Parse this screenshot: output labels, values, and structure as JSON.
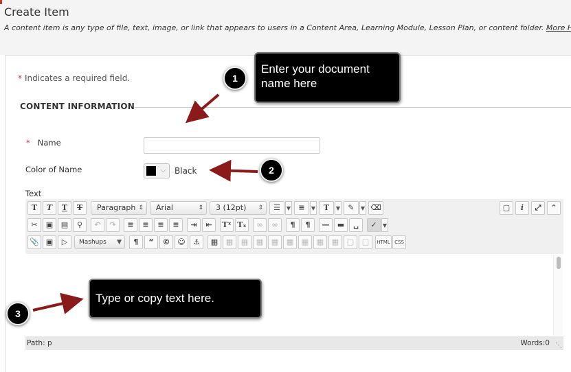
{
  "page": {
    "title": "Create Item",
    "description": "A content item is any type of file, text, image, or link that appears to users in a Content Area, Learning Module, Lesson Plan, or content folder.",
    "more_help": "More Help"
  },
  "form": {
    "required_star": "*",
    "required_note": "Indicates a required field.",
    "section_title": "CONTENT INFORMATION",
    "name_label": "Name",
    "name_value": "",
    "color_label": "Color of Name",
    "color_value": "Black",
    "color_swatch": "#000000",
    "text_label": "Text"
  },
  "editor": {
    "paragraph": "Paragraph",
    "font": "Arial",
    "size": "3 (12pt)",
    "mashups": "Mashups",
    "html_btn": "HTML",
    "css_btn": "CSS",
    "status_path": "Path: p",
    "status_words": "Words:0"
  },
  "callouts": [
    {
      "number": "1",
      "text": "Enter your document name here"
    },
    {
      "number": "2"
    },
    {
      "number": "3",
      "text": "Type or copy text here."
    }
  ],
  "colors": {
    "arrow": "#8b1a1a",
    "required": "#c0392b"
  }
}
